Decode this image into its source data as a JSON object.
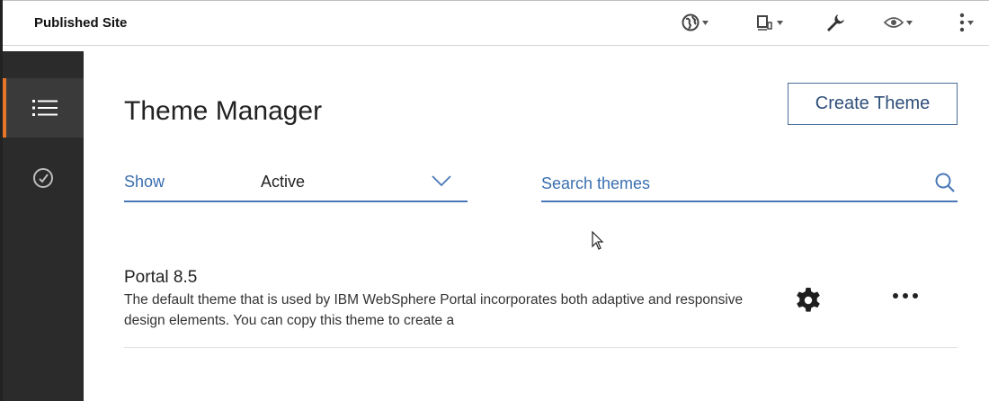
{
  "topbar": {
    "title": "Published Site",
    "icons": [
      "globe-icon",
      "device-preview-icon",
      "wrench-icon",
      "eye-icon",
      "vertical-more-icon"
    ]
  },
  "sidebar": {
    "items": [
      {
        "name": "theme-list",
        "icon": "list-icon",
        "active": true
      },
      {
        "name": "dashboard",
        "icon": "gauge-icon",
        "active": false
      }
    ]
  },
  "main": {
    "title": "Theme Manager",
    "create_button": "Create Theme",
    "filter": {
      "label": "Show",
      "value": "Active"
    },
    "search": {
      "placeholder": "Search themes",
      "value": ""
    },
    "themes": [
      {
        "name": "Portal 8.5",
        "description": "The default theme that is used by IBM WebSphere Portal incorporates both adaptive and responsive design elements. You can copy this theme to create a"
      }
    ]
  },
  "colors": {
    "accent": "#e8742a",
    "link_blue": "#3a6fb0",
    "sidebar_bg": "#2b2b2b"
  }
}
